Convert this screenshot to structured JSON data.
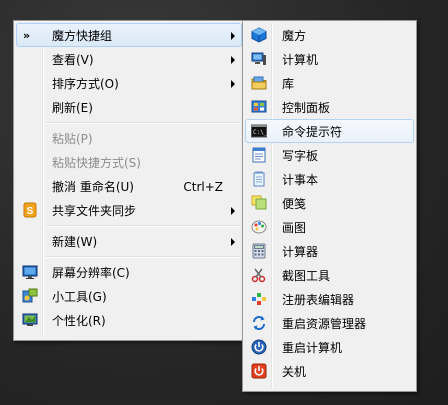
{
  "main_menu": {
    "items": [
      {
        "label": "魔方快捷组",
        "prefix": "»",
        "has_submenu": true
      },
      {
        "label": "查看(V)",
        "has_submenu": true
      },
      {
        "label": "排序方式(O)",
        "has_submenu": true
      },
      {
        "label": "刷新(E)"
      },
      {
        "label": "粘贴(P)",
        "disabled": true
      },
      {
        "label": "粘贴快捷方式(S)",
        "disabled": true
      },
      {
        "label": "撤消 重命名(U)",
        "shortcut": "Ctrl+Z"
      },
      {
        "label": "共享文件夹同步",
        "icon": "sync-s-icon",
        "has_submenu": true
      },
      {
        "label": "新建(W)",
        "has_submenu": true
      },
      {
        "label": "屏幕分辨率(C)",
        "icon": "monitor-icon"
      },
      {
        "label": "小工具(G)",
        "icon": "gadgets-icon"
      },
      {
        "label": "个性化(R)",
        "icon": "personalize-icon"
      }
    ]
  },
  "sub_menu": {
    "items": [
      {
        "label": "魔方",
        "icon": "cube-icon"
      },
      {
        "label": "计算机",
        "icon": "computer-icon"
      },
      {
        "label": "库",
        "icon": "library-icon"
      },
      {
        "label": "控制面板",
        "icon": "control-panel-icon"
      },
      {
        "label": "命令提示符",
        "icon": "cmd-icon"
      },
      {
        "label": "写字板",
        "icon": "wordpad-icon"
      },
      {
        "label": "计事本",
        "icon": "notepad-icon"
      },
      {
        "label": "便笺",
        "icon": "sticky-notes-icon"
      },
      {
        "label": "画图",
        "icon": "paint-icon"
      },
      {
        "label": "计算器",
        "icon": "calculator-icon"
      },
      {
        "label": "截图工具",
        "icon": "snipping-tool-icon"
      },
      {
        "label": "注册表编辑器",
        "icon": "regedit-icon"
      },
      {
        "label": "重启资源管理器",
        "icon": "restart-explorer-icon"
      },
      {
        "label": "重启计算机",
        "icon": "restart-icon"
      },
      {
        "label": "关机",
        "icon": "shutdown-icon"
      }
    ]
  },
  "colors": {
    "menu_bg": "#f0f0f0",
    "hover_border": "#aecff7",
    "disabled_text": "#8d8d8d"
  }
}
